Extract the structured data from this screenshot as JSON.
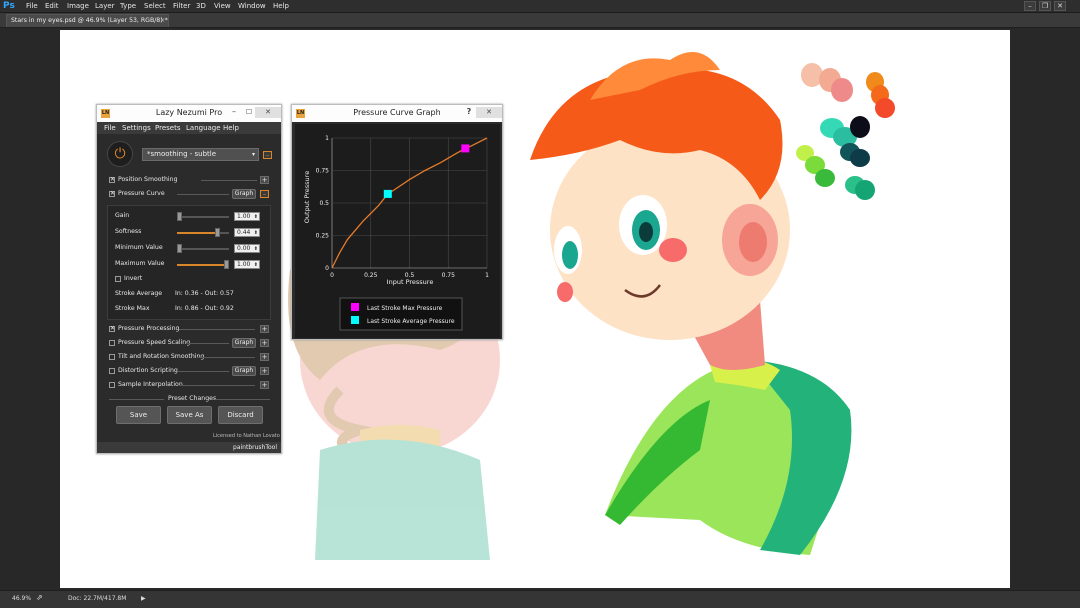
{
  "app": {
    "logo": "Ps"
  },
  "menubar": {
    "items": [
      "File",
      "Edit",
      "Image",
      "Layer",
      "Type",
      "Select",
      "Filter",
      "3D",
      "View",
      "Window",
      "Help"
    ]
  },
  "window_controls": {
    "minimize": "–",
    "restore": "❐",
    "close": "✕"
  },
  "document_tab": {
    "title": "Stars in my eyes.psd @ 46.9% (Layer 53, RGB/8) *",
    "close": "×"
  },
  "statusbar": {
    "zoom": "46.9%",
    "doc": "Doc: 22.7M/417.8M",
    "arrow": "▶"
  },
  "lazy_nezumi": {
    "title": "Lazy Nezumi Pro",
    "logo": "LN",
    "menu": [
      "File",
      "Settings",
      "Presets",
      "Language",
      "Help"
    ],
    "preset": "*smoothing - subtle",
    "power_icon": "⏻",
    "position_smoothing": {
      "label": "Position Smoothing",
      "checked": true
    },
    "pressure_curve": {
      "label": "Pressure Curve",
      "checked": true,
      "graph_label": "Graph"
    },
    "params": [
      {
        "label": "Gain",
        "value": "1.00",
        "fraction": 0.0
      },
      {
        "label": "Softness",
        "value": "0.44",
        "fraction": 0.72
      },
      {
        "label": "Minimum Value",
        "value": "0.00",
        "fraction": 0.0
      },
      {
        "label": "Maximum Value",
        "value": "1.00",
        "fraction": 0.92
      }
    ],
    "invert": {
      "label": "Invert",
      "checked": false
    },
    "stroke_average": {
      "label": "Stroke Average",
      "value": "In: 0.36 - Out: 0.57"
    },
    "stroke_max": {
      "label": "Stroke Max",
      "value": "In: 0.86 - Out: 0.92"
    },
    "options": [
      {
        "label": "Pressure Processing",
        "checked": true,
        "graph": ""
      },
      {
        "label": "Pressure Speed Scaling",
        "checked": false,
        "graph": "Graph"
      },
      {
        "label": "Tilt and Rotation Smoothing",
        "checked": false,
        "graph": ""
      },
      {
        "label": "Distortion Scripting",
        "checked": false,
        "graph": "Graph"
      },
      {
        "label": "Sample Interpolation",
        "checked": false,
        "graph": ""
      }
    ],
    "preset_changes": "Preset Changes",
    "buttons": {
      "save": "Save",
      "save_as": "Save As",
      "discard": "Discard"
    },
    "licensed": "Licensed to Nathan Lovato",
    "tool": "paintbrushTool",
    "plus": "+",
    "minus": "–"
  },
  "graph_panel": {
    "title": "Pressure Curve Graph",
    "logo": "LN",
    "help": "?",
    "xlabel": "Input Pressure",
    "ylabel": "Output Pressure",
    "x_ticks": [
      "0",
      "0.25",
      "0.5",
      "0.75",
      "1"
    ],
    "y_ticks": [
      "0",
      "0.25",
      "0.5",
      "0.75",
      "1"
    ],
    "legend": [
      {
        "label": "Last Stroke Max Pressure",
        "color": "#ff00ff"
      },
      {
        "label": "Last Stroke Average Pressure",
        "color": "#00ffff"
      }
    ]
  },
  "chart_data": {
    "type": "line",
    "xlabel": "Input Pressure",
    "ylabel": "Output Pressure",
    "xlim": [
      0,
      1
    ],
    "ylim": [
      0,
      1
    ],
    "grid": true,
    "x": [
      0,
      0.05,
      0.1,
      0.2,
      0.3,
      0.36,
      0.4,
      0.5,
      0.6,
      0.7,
      0.8,
      0.86,
      0.9,
      1.0
    ],
    "series": [
      {
        "values": [
          0,
          0.12,
          0.22,
          0.36,
          0.48,
          0.57,
          0.6,
          0.68,
          0.75,
          0.81,
          0.88,
          0.92,
          0.94,
          1.0
        ]
      }
    ],
    "markers": [
      {
        "name": "Last Stroke Max Pressure",
        "x": 0.86,
        "y": 0.92,
        "color": "#ff00ff"
      },
      {
        "name": "Last Stroke Average Pressure",
        "x": 0.36,
        "y": 0.57,
        "color": "#00ffff"
      }
    ]
  }
}
